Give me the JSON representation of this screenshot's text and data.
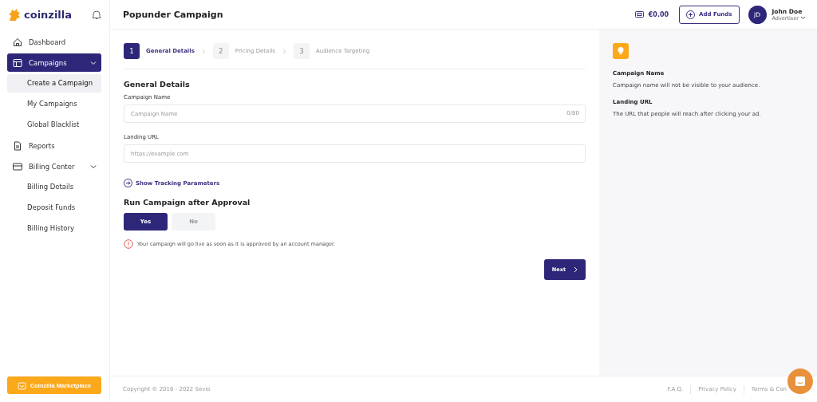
{
  "brand": {
    "name": "coinzilla"
  },
  "nav": [
    {
      "label": "Dashboard",
      "selected": false
    },
    {
      "label": "Campaigns",
      "selected": true,
      "expanded": true,
      "children": [
        {
          "label": "Create a Campaign",
          "selected": true
        },
        {
          "label": "My Campaigns",
          "selected": false
        },
        {
          "label": "Global Blacklist",
          "selected": false
        }
      ]
    },
    {
      "label": "Reports",
      "selected": false
    },
    {
      "label": "Billing Center",
      "selected": false,
      "expanded": true,
      "children": [
        {
          "label": "Billing Details",
          "selected": false
        },
        {
          "label": "Deposit Funds",
          "selected": false
        },
        {
          "label": "Billing History",
          "selected": false
        }
      ]
    }
  ],
  "marketplace_button": "Coinzilla Marketplace",
  "header": {
    "title": "Popunder Campaign",
    "balance": "€0.00",
    "add_funds": "Add Funds",
    "user": {
      "initials": "JD",
      "name": "John Doe",
      "role": "Advertiser"
    }
  },
  "steps": [
    {
      "number": "1",
      "label": "General Details",
      "selected": true
    },
    {
      "number": "2",
      "label": "Pricing Details",
      "selected": false
    },
    {
      "number": "3",
      "label": "Audience Targeting",
      "selected": false
    }
  ],
  "form": {
    "heading": "General Details",
    "fields": [
      {
        "label": "Campaign Name",
        "placeholder": "Campaign Name",
        "counter": "0/80"
      },
      {
        "label": "Landing URL",
        "placeholder": "https://example.com"
      }
    ],
    "tracking_link": "Show Tracking Parameters",
    "approval": {
      "heading": "Run Campaign after Approval",
      "options": [
        {
          "label": "Yes",
          "selected": true
        },
        {
          "label": "No",
          "selected": false
        }
      ],
      "notice": "Your campaign will go live as soon as it is approved by an account manager."
    },
    "next_button": "Next"
  },
  "help": [
    {
      "title": "Campaign Name",
      "text": "Campaign name will not be visible to your audience."
    },
    {
      "title": "Landing URL",
      "text": "The URL that people will reach after clicking your ad."
    }
  ],
  "footer": {
    "copyright": "Copyright © 2016 - 2022 Sevio",
    "links": [
      "F.A.Q.",
      "Privacy Policy",
      "Terms & Con"
    ]
  }
}
